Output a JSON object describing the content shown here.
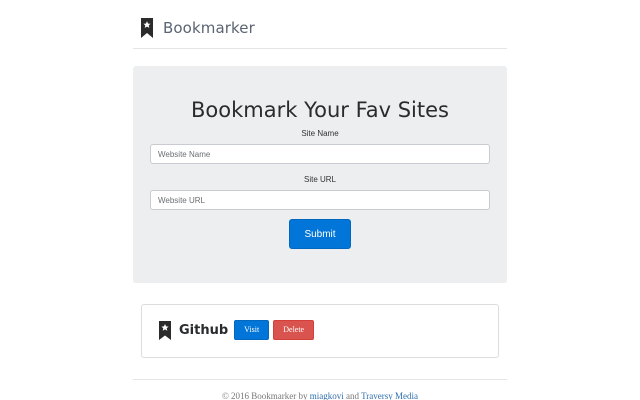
{
  "header": {
    "brand_name": "Bookmarker",
    "brand_icon": "bookmark-star-icon"
  },
  "form": {
    "title": "Bookmark Your Fav Sites",
    "site_name_label": "Site Name",
    "site_name_placeholder": "Website Name",
    "site_name_value": "",
    "site_url_label": "Site URL",
    "site_url_placeholder": "Website URL",
    "site_url_value": "",
    "submit_label": "Submit"
  },
  "bookmarks": [
    {
      "name": "Github",
      "icon": "bookmark-star-icon",
      "visit_label": "Visit",
      "delete_label": "Delete"
    }
  ],
  "footer": {
    "prefix": "© 2016 Bookmarker by ",
    "author1": "miagkovi",
    "joiner": " and ",
    "author2": "Traversy Media"
  },
  "colors": {
    "primary": "#0275d8",
    "danger": "#d9534f",
    "jumbotron_bg": "#eceeef",
    "brand_text": "#5b6472"
  }
}
